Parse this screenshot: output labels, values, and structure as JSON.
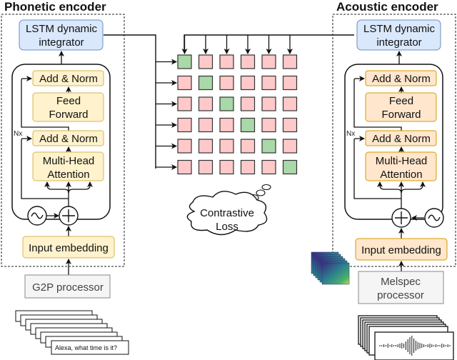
{
  "phonetic_encoder": {
    "title": "Phonetic encoder",
    "lstm": [
      "LSTM dynamic",
      "integrator"
    ],
    "add_norm_top": "Add & Norm",
    "feed_forward": [
      "Feed",
      "Forward"
    ],
    "add_norm_bottom": "Add & Norm",
    "attention": [
      "Multi-Head",
      "Attention"
    ],
    "repeat_label": "Nx",
    "input_embedding": "Input embedding",
    "processor": [
      "G2P processor"
    ],
    "input_sample_text": "Alexa, what time is it?"
  },
  "acoustic_encoder": {
    "title": "Acoustic encoder",
    "lstm": [
      "LSTM dynamic",
      "integrator"
    ],
    "add_norm_top": "Add & Norm",
    "feed_forward": [
      "Feed",
      "Forward"
    ],
    "add_norm_bottom": "Add & Norm",
    "attention": [
      "Multi-Head",
      "Attention"
    ],
    "repeat_label": "Nx",
    "input_embedding": "Input embedding",
    "processor": [
      "Melspec",
      "processor"
    ]
  },
  "similarity_matrix": {
    "rows": 6,
    "cols": 6,
    "positive_color": "#a9d8a9",
    "negative_color": "#ffc9c9"
  },
  "loss": [
    "Contrastive",
    "Loss"
  ],
  "colors": {
    "lstm_fill": "#dae8fc",
    "lstm_stroke": "#6c8ebf",
    "phonetic_block_fill": "#fff2cc",
    "phonetic_block_stroke": "#d6b656",
    "acoustic_block_fill": "#ffe6cc",
    "acoustic_block_stroke": "#d79b00",
    "processor_fill": "#f5f5f5",
    "processor_stroke": "#666666"
  }
}
